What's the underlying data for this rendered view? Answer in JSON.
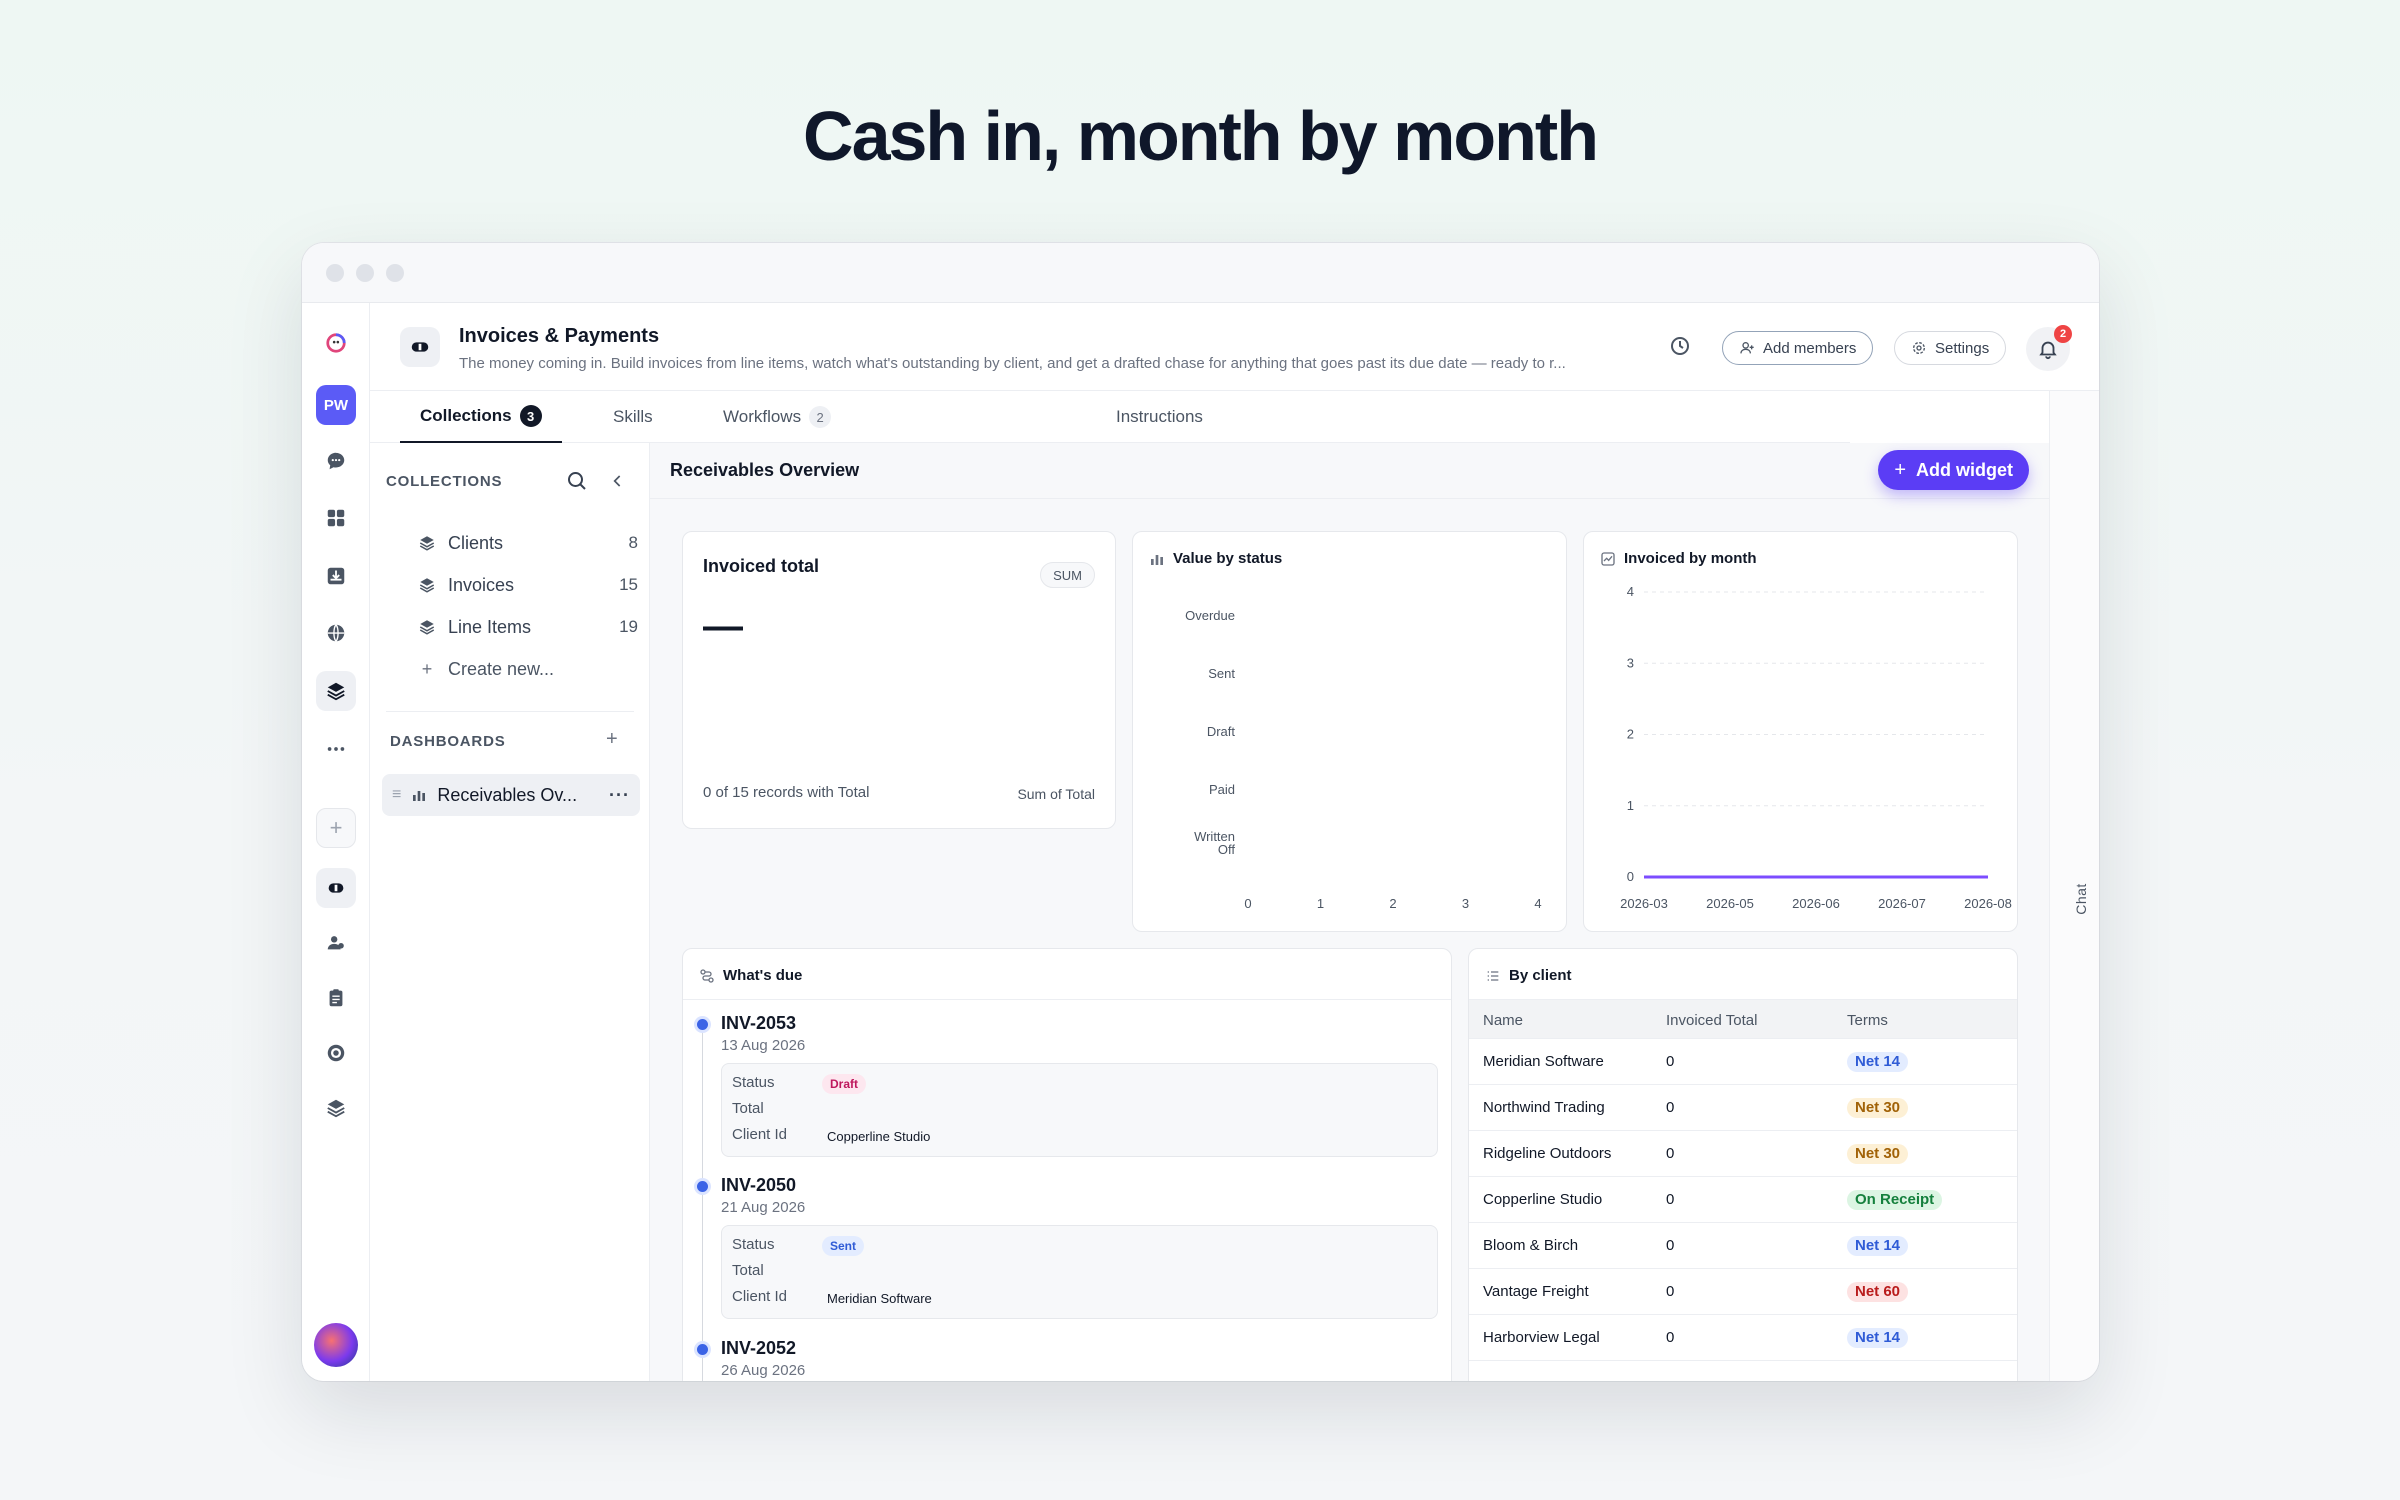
{
  "headline": "Cash in, month by month",
  "app": {
    "title": "Invoices & Payments",
    "description": "The money coming in. Build invoices from line items, watch what's outstanding by client, and get a drafted chase for anything that goes past its due date — ready to r...",
    "add_members": "Add members",
    "settings": "Settings",
    "notifications": "2"
  },
  "rail": {
    "workspace_initials": "PW"
  },
  "tabs": [
    {
      "label": "Collections",
      "count": "3"
    },
    {
      "label": "Skills"
    },
    {
      "label": "Workflows",
      "count": "2"
    },
    {
      "label": "Instructions"
    }
  ],
  "chat_label": "Chat",
  "collections": {
    "heading": "COLLECTIONS",
    "items": [
      {
        "label": "Clients",
        "count": "8"
      },
      {
        "label": "Invoices",
        "count": "15"
      },
      {
        "label": "Line Items",
        "count": "19"
      }
    ],
    "create": "Create new..."
  },
  "dashboards": {
    "heading": "DASHBOARDS",
    "items": [
      {
        "label": "Receivables Ov..."
      }
    ]
  },
  "dashboard": {
    "title": "Receivables Overview",
    "add_widget": "Add widget"
  },
  "invoiced_total": {
    "title": "Invoiced total",
    "agg": "SUM",
    "value": "—",
    "footer_left": "0 of 15 records with Total",
    "footer_right": "Sum of Total"
  },
  "chart_data": [
    {
      "type": "bar",
      "title": "Value by status",
      "orientation": "horizontal",
      "categories": [
        "Overdue",
        "Sent",
        "Draft",
        "Paid",
        "Written Off"
      ],
      "values": [
        0,
        0,
        0,
        0,
        0
      ],
      "xticks": [
        "0",
        "1",
        "2",
        "3",
        "4"
      ],
      "xlim": [
        0,
        4
      ]
    },
    {
      "type": "line",
      "title": "Invoiced by month",
      "x": [
        "2026-03",
        "2026-05",
        "2026-06",
        "2026-07",
        "2026-08"
      ],
      "y": [
        0,
        0,
        0,
        0,
        0
      ],
      "yticks": [
        "0",
        "1",
        "2",
        "3",
        "4"
      ],
      "ylim": [
        0,
        4
      ],
      "grid": true,
      "color": "#7c4dff"
    }
  ],
  "whats_due": {
    "title": "What's due",
    "labels": {
      "status": "Status",
      "total": "Total",
      "client": "Client Id"
    },
    "items": [
      {
        "id": "INV-2053",
        "date": "13 Aug 2026",
        "status": "Draft",
        "status_bg": "#fde7ef",
        "status_fg": "#be185d",
        "total": "",
        "client": "Copperline Studio"
      },
      {
        "id": "INV-2050",
        "date": "21 Aug 2026",
        "status": "Sent",
        "status_bg": "#e3ecff",
        "status_fg": "#2f5bd6",
        "total": "",
        "client": "Meridian Software"
      },
      {
        "id": "INV-2052",
        "date": "26 Aug 2026"
      }
    ]
  },
  "by_client": {
    "title": "By client",
    "columns": [
      "Name",
      "Invoiced Total",
      "Terms"
    ],
    "rows": [
      {
        "name": "Meridian Software",
        "total": "0",
        "terms": "Net 14",
        "bg": "#e3ecff",
        "fg": "#2f5bd6"
      },
      {
        "name": "Northwind Trading",
        "total": "0",
        "terms": "Net 30",
        "bg": "#fdf0d5",
        "fg": "#a16207"
      },
      {
        "name": "Ridgeline Outdoors",
        "total": "0",
        "terms": "Net 30",
        "bg": "#fdf0d5",
        "fg": "#a16207"
      },
      {
        "name": "Copperline Studio",
        "total": "0",
        "terms": "On Receipt",
        "bg": "#dcf5e3",
        "fg": "#15803d"
      },
      {
        "name": "Bloom & Birch",
        "total": "0",
        "terms": "Net 14",
        "bg": "#e3ecff",
        "fg": "#2f5bd6"
      },
      {
        "name": "Vantage Freight",
        "total": "0",
        "terms": "Net 60",
        "bg": "#fde2e2",
        "fg": "#b91c1c"
      },
      {
        "name": "Harborview Legal",
        "total": "0",
        "terms": "Net 14",
        "bg": "#e3ecff",
        "fg": "#2f5bd6"
      }
    ]
  },
  "colors": {
    "accent": "#5b3df5",
    "brand": "#5b5bf6"
  }
}
